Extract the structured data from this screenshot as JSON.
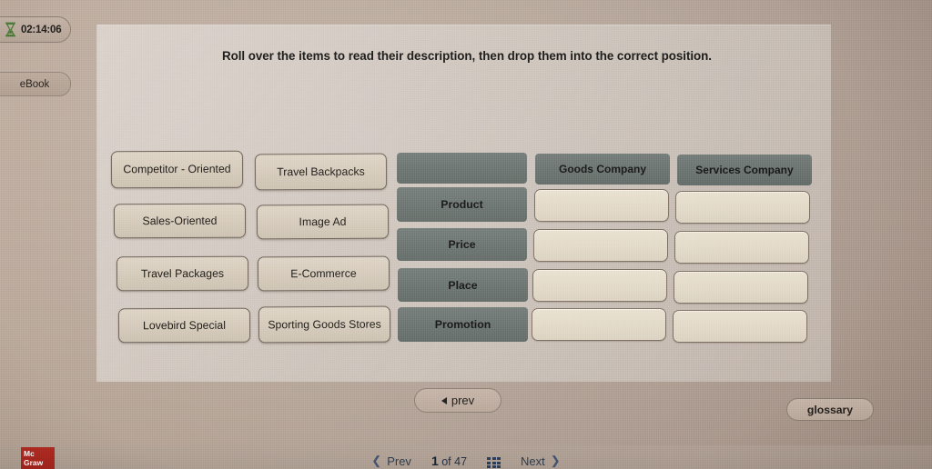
{
  "timer": {
    "icon": "hourglass-icon",
    "value": "02:14:06"
  },
  "ebook_tab": {
    "label": "eBook"
  },
  "instruction": {
    "text": "Roll over the items to read their description, then drop them into the correct position."
  },
  "items": [
    {
      "label": "Competitor - Oriented"
    },
    {
      "label": "Travel Backpacks"
    },
    {
      "label": "Sales-Oriented"
    },
    {
      "label": "Image Ad"
    },
    {
      "label": "Travel Packages"
    },
    {
      "label": "E-Commerce"
    },
    {
      "label": "Lovebird Special"
    },
    {
      "label": "Sporting Goods Stores"
    }
  ],
  "grid": {
    "corner_label": "",
    "column_headers": [
      "Goods Company",
      "Services Company"
    ],
    "row_labels": [
      "Product",
      "Price",
      "Place",
      "Promotion"
    ],
    "cells": [
      [
        "",
        ""
      ],
      [
        "",
        ""
      ],
      [
        "",
        ""
      ],
      [
        "",
        ""
      ]
    ]
  },
  "buttons": {
    "prev": "prev",
    "glossary": "glossary"
  },
  "bottom_bar": {
    "prev_label": "Prev",
    "next_label": "Next",
    "page_current": "1",
    "page_of": "of",
    "page_total": "47",
    "grid_icon": "grid-view-icon",
    "logo_line1": "Mc",
    "logo_line2": "Graw"
  },
  "colors": {
    "desktop_bg": "#a99788",
    "panel_bg": "#ded8d2",
    "header_cell": "#6a726f",
    "drop_zone": "#e3d9c7",
    "item_tile": "#d6cbba",
    "logo_red": "#a8241d",
    "timer_icon_green": "#4e7a3a"
  }
}
